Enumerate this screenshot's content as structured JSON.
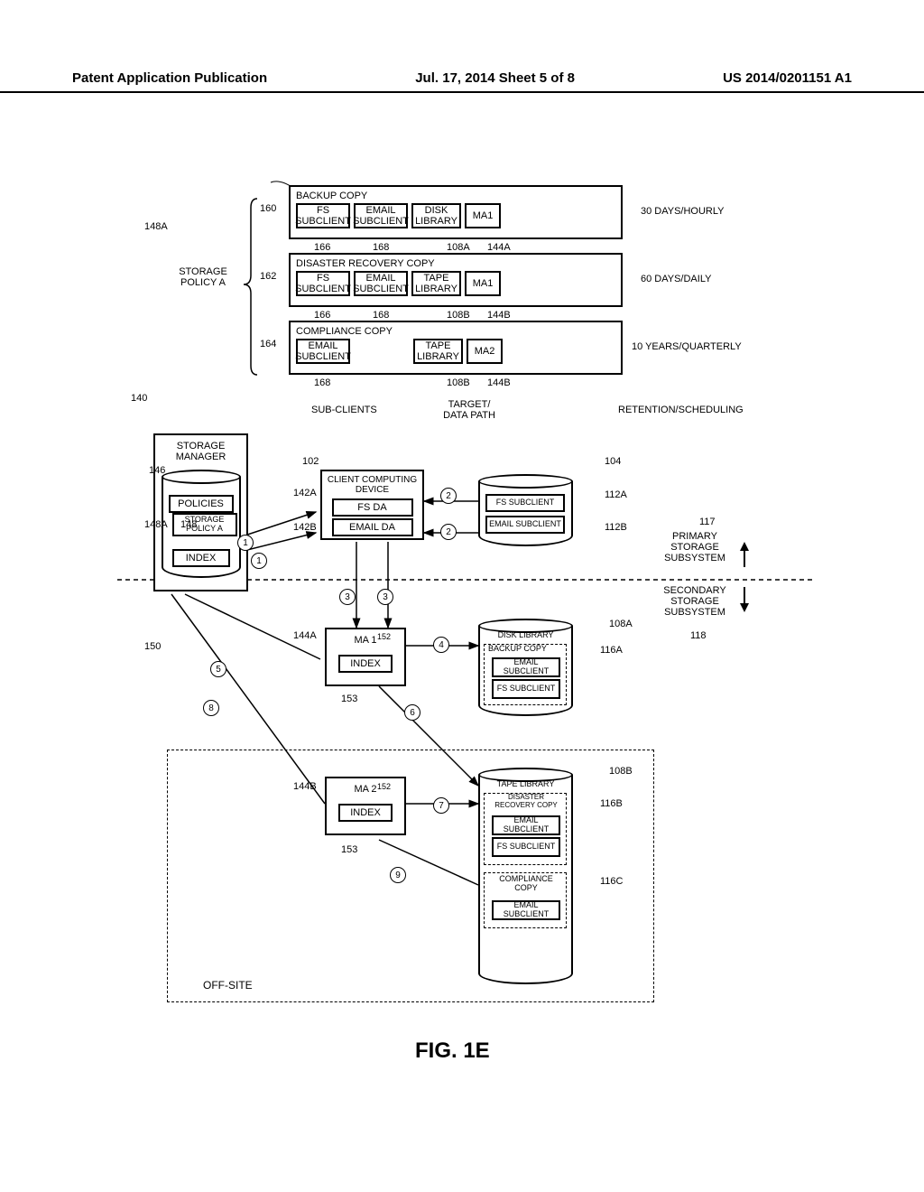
{
  "header": {
    "left": "Patent Application Publication",
    "center": "Jul. 17, 2014  Sheet 5 of 8",
    "right": "US 2014/0201151 A1"
  },
  "figure_label": "FIG. 1E",
  "policy": {
    "title": "STORAGE POLICY A",
    "ref_148A": "148A",
    "rows": [
      {
        "ref": "160",
        "name": "BACKUP COPY",
        "sub1": "FS SUBCLIENT",
        "sub1_ref": "166",
        "sub2": "EMAIL SUBCLIENT",
        "sub2_ref": "168",
        "target": "DISK LIBRARY",
        "target_ref": "108A",
        "ma": "MA1",
        "ma_ref": "144A",
        "retention": "30 DAYS/HOURLY"
      },
      {
        "ref": "162",
        "name": "DISASTER RECOVERY COPY",
        "sub1": "FS SUBCLIENT",
        "sub1_ref": "166",
        "sub2": "EMAIL SUBCLIENT",
        "sub2_ref": "168",
        "target": "TAPE LIBRARY",
        "target_ref": "108B",
        "ma": "MA1",
        "ma_ref": "144B",
        "retention": "60 DAYS/DAILY"
      },
      {
        "ref": "164",
        "name": "COMPLIANCE COPY",
        "sub1": "EMAIL SUBCLIENT",
        "sub1_ref": "168",
        "target": "TAPE LIBRARY",
        "target_ref": "108B",
        "ma": "MA2",
        "ma_ref": "144B",
        "retention": "10 YEARS/QUARTERLY"
      }
    ],
    "col_labels": {
      "subclients": "SUB-CLIENTS",
      "target": "TARGET/ DATA PATH",
      "retention": "RETENTION/SCHEDULING"
    }
  },
  "storage_manager": {
    "title": "STORAGE MANAGER",
    "ref_140": "140",
    "ref_146": "146",
    "policies": "POLICIES",
    "storage_policy_a": "STORAGE POLICY A",
    "index": "INDEX",
    "ref_148A": "148A",
    "ref_148": "148",
    "ref_150": "150"
  },
  "client": {
    "title": "CLIENT COMPUTING DEVICE",
    "fs_da": "FS DA",
    "email_da": "EMAIL DA",
    "ref_102": "102",
    "ref_142A": "142A",
    "ref_142B": "142B"
  },
  "primary_data": {
    "fs": "FS SUBCLIENT",
    "email": "EMAIL SUBCLIENT",
    "ref_104": "104",
    "ref_112A": "112A",
    "ref_112B": "112B"
  },
  "subsystems": {
    "primary": "PRIMARY STORAGE SUBSYSTEM",
    "secondary": "SECONDARY STORAGE SUBSYSTEM",
    "ref_117": "117",
    "ref_118": "118"
  },
  "ma1": {
    "title": "MA 1",
    "index": "INDEX",
    "ref_144A": "144A",
    "ref_152": "152",
    "ref_153": "153"
  },
  "ma2": {
    "title": "MA 2",
    "index": "INDEX",
    "ref_144B": "144B",
    "ref_152": "152",
    "ref_153": "153"
  },
  "disk_library": {
    "title": "DISK LIBRARY",
    "backup_copy": "BACKUP COPY",
    "email_sub": "EMAIL SUBCLIENT",
    "fs_sub": "FS SUBCLIENT",
    "ref_108A": "108A",
    "ref_116A": "116A"
  },
  "tape_library": {
    "title": "TAPE LIBRARY",
    "dr_copy": "DISASTER RECOVERY COPY",
    "email_sub": "EMAIL SUBCLIENT",
    "fs_sub": "FS SUBCLIENT",
    "compliance": "COMPLIANCE COPY",
    "email_sub2": "EMAIL SUBCLIENT",
    "ref_108B": "108B",
    "ref_116B": "116B",
    "ref_116C": "116C"
  },
  "offsite": "OFF-SITE",
  "steps": {
    "s1": "1",
    "s2": "2",
    "s3": "3",
    "s4": "4",
    "s5": "5",
    "s6": "6",
    "s7": "7",
    "s8": "8",
    "s9": "9"
  }
}
